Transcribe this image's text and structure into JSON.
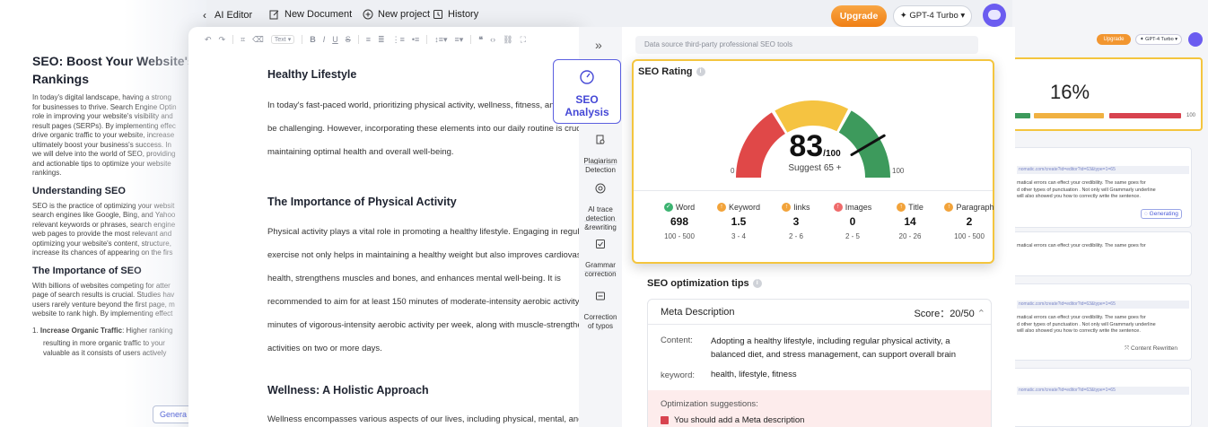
{
  "header": {
    "back_label": "AI Editor",
    "new_document": "New Document",
    "new_project": "New project",
    "history": "History",
    "upgrade": "Upgrade",
    "model": "GPT-4 Turbo"
  },
  "bg_doc": {
    "title": "SEO: Boost Your Website's V\nRankings",
    "intro": "In today's digital landscape, having a strong\nfor businesses to thrive. Search Engine Optin\nrole in improving your website's visibility and\nresult pages (SERPs). By implementing effec\ndrive organic traffic to your website, increase\nultimately boost your business's success. In\nwe will delve into the world of SEO, providing\nand actionable tips to optimize your website\nrankings.",
    "h_understanding": "Understanding SEO",
    "understanding": "SEO is the practice of optimizing your websit\nsearch engines like Google, Bing, and Yahoo\nrelevant keywords or phrases, search engine\nweb pages to provide the most relevant and\noptimizing your website's content, structure,\nincrease its chances of appearing on the firs",
    "h_importance": "The Importance of SEO",
    "importance": "With billions of websites competing for atter\npage of search results is crucial. Studies hav\nusers rarely venture beyond the first page, m\nwebsite to rank high. By implementing effect",
    "li1_bold": "Increase Organic Traffic",
    "li1_rest": ": Higher ranking",
    "li1_cont": "resulting in more organic traffic to your\nvaluable as it consists of users actively",
    "generate_label": "Genera"
  },
  "bg_right": {
    "upgrade": "Upgrade",
    "model": "GPT-4 Turbo",
    "score": "16%",
    "bar_max": "100",
    "link": "nomatic.com/create?id=editor?id=63&type=1=65",
    "card1_text": "matical errors can effect your credibility. The same goes for\nd other types of punctuation . Not only will Grammarly underline\nwill also showed you how to correctly write the sentence.",
    "generating": "Generating",
    "card2_text": "matical errors can effect your credibility. The same goes for",
    "content_rewritten": "Content Rewritten"
  },
  "toolbar": {
    "text_dropdown": "Text"
  },
  "editor": {
    "h1": "Healthy Lifestyle",
    "p1": "In today's fast-paced world, prioritizing physical activity, wellness, fitness, and\nbe challenging. However, incorporating these elements into our daily routine is crucial\nmaintaining optimal health and overall well-being.",
    "h2": "The Importance of Physical Activity",
    "p2": "Physical activity plays a vital role in promoting a healthy lifestyle. Engaging in regular\nexercise not only helps in maintaining a healthy weight but also improves cardiovascu\nhealth, strengthens muscles and bones, and enhances mental well-being. It is\nrecommended to aim for at least 150 minutes of moderate-intensity aerobic activity or\nminutes of vigorous-intensity aerobic activity per week, along with muscle-strengthe\nactivities on two or more days.",
    "h3": "Wellness: A Holistic Approach",
    "p3": "Wellness encompasses various aspects of our lives, including physical, mental, and"
  },
  "sidebar": {
    "seo_analysis": "SEO\nAnalysis",
    "plagiarism": "Plagiarism\nDetection",
    "ai_trace": "AI trace\ndetection\n&rewriting",
    "grammar": "Grammar\ncorrection",
    "typos": "Correction\nof typos"
  },
  "panel": {
    "datasource": "Data source third-party professional SEO tools",
    "rating_title": "SEO Rating",
    "score": "83",
    "score_max": "/100",
    "score_value": 83,
    "suggest": "Suggest 65 +",
    "gauge_min": "0",
    "gauge_max": "100",
    "metrics": [
      {
        "label": "Word",
        "value": "698",
        "range": "100 - 500",
        "status": "ok",
        "color": "#3cb371"
      },
      {
        "label": "Keyword",
        "value": "1.5",
        "range": "3 - 4",
        "status": "up",
        "color": "#f2a33a"
      },
      {
        "label": "links",
        "value": "3",
        "range": "2 - 6",
        "status": "up",
        "color": "#f2a33a"
      },
      {
        "label": "Images",
        "value": "0",
        "range": "2 - 5",
        "status": "up",
        "color": "#ef6b6b"
      },
      {
        "label": "Title",
        "value": "14",
        "range": "20 - 26",
        "status": "up",
        "color": "#f2a33a"
      },
      {
        "label": "Paragraph",
        "value": "2",
        "range": "100 - 500",
        "status": "up",
        "color": "#f2a33a"
      }
    ],
    "tips_title": "SEO optimization tips",
    "meta_title": "Meta Description",
    "meta_score": "Score：20/50",
    "content_label": "Content:",
    "content_value": "Adopting a healthy lifestyle, including regular physical activity, a balanced diet, and stress management, can support overall brain",
    "keyword_label": "keyword:",
    "keyword_value": "health, lifestyle, fitness",
    "suggestions_title": "Optimization suggestions:",
    "suggestion_1": "You should add a Meta description"
  },
  "colors": {
    "accent": "#5b5fe0",
    "upgrade": "#f29630",
    "gauge_red": "#e04848",
    "gauge_yellow": "#f5c341",
    "gauge_green": "#3d9a5c",
    "card_border": "#f4c53e"
  }
}
